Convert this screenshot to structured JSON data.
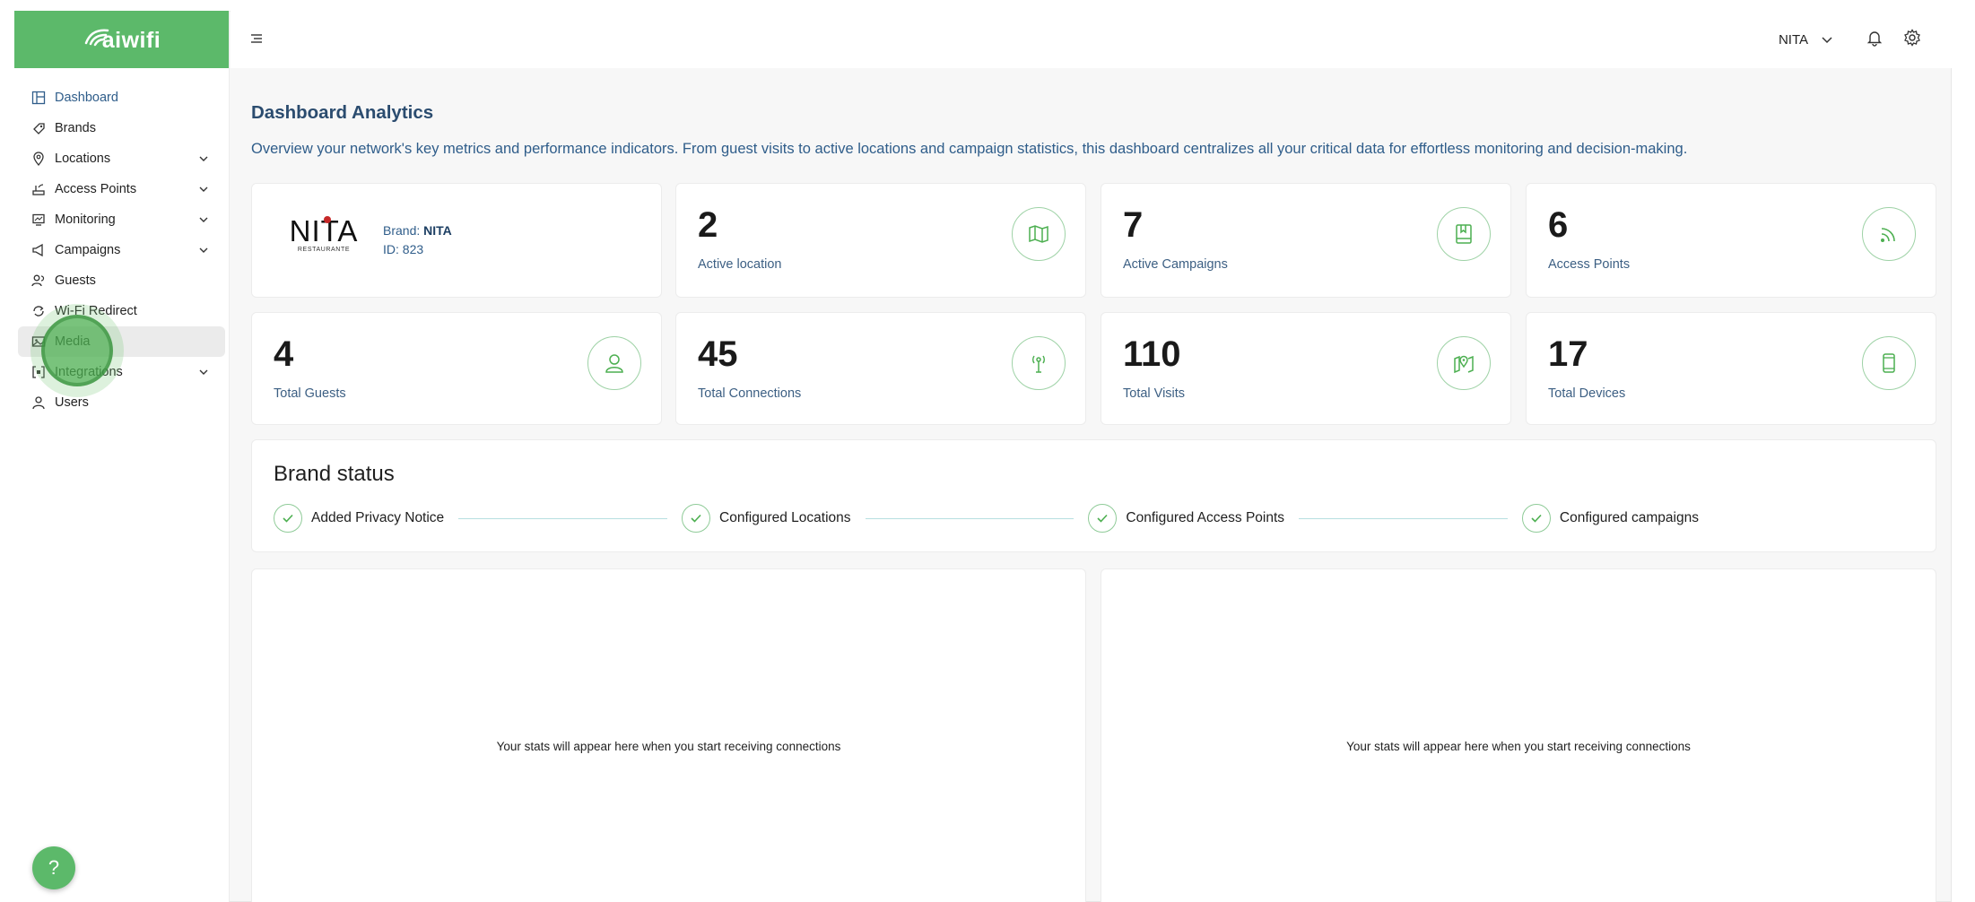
{
  "app": {
    "logo_text": "aiwifi"
  },
  "sidebar": {
    "items": [
      {
        "label": "Dashboard",
        "icon": "dashboard-icon",
        "has_children": false
      },
      {
        "label": "Brands",
        "icon": "brands-icon",
        "has_children": false
      },
      {
        "label": "Locations",
        "icon": "location-pin-icon",
        "has_children": true
      },
      {
        "label": "Access Points",
        "icon": "router-icon",
        "has_children": true
      },
      {
        "label": "Monitoring",
        "icon": "monitor-icon",
        "has_children": true
      },
      {
        "label": "Campaigns",
        "icon": "megaphone-icon",
        "has_children": true
      },
      {
        "label": "Guests",
        "icon": "guests-icon",
        "has_children": false
      },
      {
        "label": "Wi-Fi Redirect",
        "icon": "redirect-icon",
        "has_children": false
      },
      {
        "label": "Media",
        "icon": "media-icon",
        "has_children": false
      },
      {
        "label": "Integrations",
        "icon": "integrations-icon",
        "has_children": true
      },
      {
        "label": "Users",
        "icon": "user-icon",
        "has_children": false
      }
    ],
    "active": "Dashboard",
    "hovered": "Media"
  },
  "help": {
    "label": "?"
  },
  "header": {
    "user_name": "NITA"
  },
  "page": {
    "title": "Dashboard Analytics",
    "description": "Overview your network's key metrics and performance indicators. From guest visits to active locations and campaign statistics, this dashboard centralizes all your critical data for effortless monitoring and decision-making."
  },
  "brand_card": {
    "logo_name": "NITA",
    "logo_sub": "RESTAURANTE",
    "brand_label": "Brand:",
    "brand_value": "NITA",
    "id_label": "ID:",
    "id_value": "823"
  },
  "stats": [
    {
      "value": "2",
      "label": "Active location",
      "icon": "map-icon"
    },
    {
      "value": "7",
      "label": "Active Campaigns",
      "icon": "bookmark-book-icon"
    },
    {
      "value": "6",
      "label": "Access Points",
      "icon": "wifi-signal-icon"
    },
    {
      "value": "4",
      "label": "Total Guests",
      "icon": "user-icon"
    },
    {
      "value": "45",
      "label": "Total Connections",
      "icon": "antenna-icon"
    },
    {
      "value": "110",
      "label": "Total Visits",
      "icon": "map-pin-icon"
    },
    {
      "value": "17",
      "label": "Total Devices",
      "icon": "mobile-device-icon"
    }
  ],
  "brand_status": {
    "title": "Brand status",
    "steps": [
      {
        "label": "Added Privacy Notice",
        "done": true
      },
      {
        "label": "Configured Locations",
        "done": true
      },
      {
        "label": "Configured Access Points",
        "done": true
      },
      {
        "label": "Configured campaigns",
        "done": true
      }
    ]
  },
  "panels": [
    {
      "empty_message": "Your stats will appear here when you start receiving connections"
    },
    {
      "empty_message": "Your stats will appear here when you start receiving connections"
    }
  ],
  "colors": {
    "brand_green": "#5cb96a",
    "text_blue": "#2f5d8a",
    "icon_border": "#9ed2a6"
  }
}
